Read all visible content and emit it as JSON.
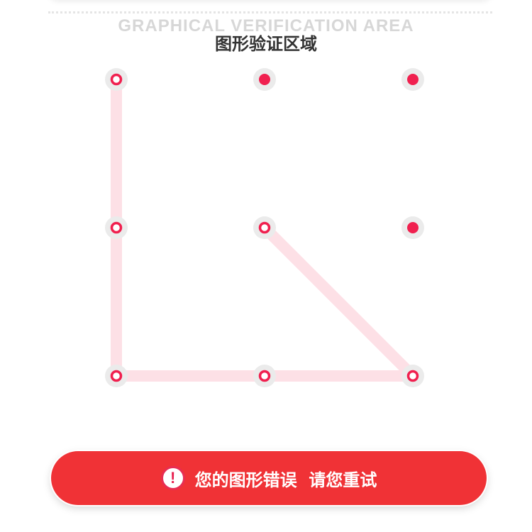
{
  "header": {
    "title_en": "GRAPHICAL VERIFICATION AREA",
    "title_zh": "图形验证区域"
  },
  "pattern": {
    "grid_size": 3,
    "nodes": [
      {
        "row": 0,
        "col": 0,
        "selected": true
      },
      {
        "row": 0,
        "col": 1,
        "selected": false
      },
      {
        "row": 0,
        "col": 2,
        "selected": false
      },
      {
        "row": 1,
        "col": 0,
        "selected": true
      },
      {
        "row": 1,
        "col": 1,
        "selected": true
      },
      {
        "row": 1,
        "col": 2,
        "selected": false
      },
      {
        "row": 2,
        "col": 0,
        "selected": true
      },
      {
        "row": 2,
        "col": 1,
        "selected": true
      },
      {
        "row": 2,
        "col": 2,
        "selected": true
      }
    ],
    "path": [
      {
        "row": 0,
        "col": 0
      },
      {
        "row": 1,
        "col": 0
      },
      {
        "row": 2,
        "col": 0
      },
      {
        "row": 2,
        "col": 1
      },
      {
        "row": 2,
        "col": 2
      },
      {
        "row": 1,
        "col": 1
      }
    ],
    "colors": {
      "node_halo": "#ebebeb",
      "node_dot": "#f0204f",
      "path_line": "#fde0e6"
    }
  },
  "error": {
    "icon": "exclamation-icon",
    "icon_glyph": "!",
    "message": "您的图形错误  请您重试",
    "color": "#f03236"
  }
}
